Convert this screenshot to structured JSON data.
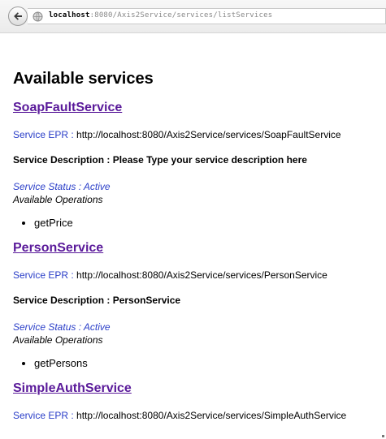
{
  "browser": {
    "url_host": "localhost",
    "url_rest": ":8080/Axis2Service/services/listServices"
  },
  "page": {
    "title": "Available services",
    "epr_label": "Service EPR :",
    "status_label": "Service Status : Active",
    "ops_label": "Available Operations"
  },
  "services": [
    {
      "name": "SoapFaultService",
      "epr": "http://localhost:8080/Axis2Service/services/SoapFaultService",
      "description": "Service Description : Please Type your service description here",
      "operations": [
        "getPrice"
      ]
    },
    {
      "name": "PersonService",
      "epr": "http://localhost:8080/Axis2Service/services/PersonService",
      "description": "Service Description : PersonService",
      "operations": [
        "getPersons"
      ]
    },
    {
      "name": "SimpleAuthService",
      "epr": "http://localhost:8080/Axis2Service/services/SimpleAuthService"
    }
  ]
}
